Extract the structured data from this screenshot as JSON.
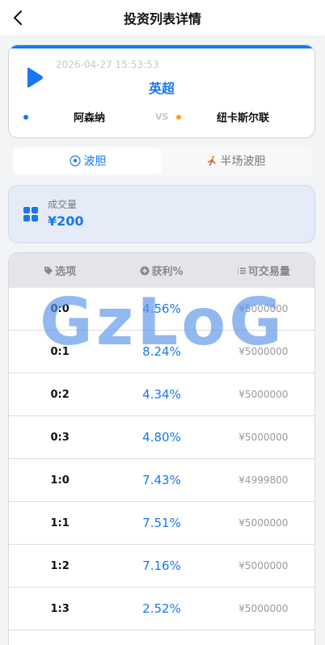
{
  "header": {
    "title": "投资列表详情"
  },
  "match": {
    "datetime": "2026-04-27 15:53:53",
    "league": "英超",
    "home_team": "阿森纳",
    "vs": "VS",
    "away_team": "纽卡斯尔联",
    "home_color": "#1877f2",
    "away_color": "#f6a11a"
  },
  "tabs": [
    {
      "label": "波胆",
      "icon": "soccer-ball-icon",
      "active": true
    },
    {
      "label": "半场波胆",
      "icon": "runner-icon",
      "active": false
    }
  ],
  "volume": {
    "label": "成交量",
    "value": "¥200"
  },
  "table": {
    "headers": [
      "选项",
      "获利%",
      "可交易量"
    ],
    "header_icons": [
      "tag-icon",
      "plus-circle-icon",
      "list-icon"
    ],
    "rows": [
      {
        "score": "0:0",
        "profit": "4.56%",
        "available": "¥5000000"
      },
      {
        "score": "0:1",
        "profit": "8.24%",
        "available": "¥5000000"
      },
      {
        "score": "0:2",
        "profit": "4.34%",
        "available": "¥5000000"
      },
      {
        "score": "0:3",
        "profit": "4.80%",
        "available": "¥5000000"
      },
      {
        "score": "1:0",
        "profit": "7.43%",
        "available": "¥4999800"
      },
      {
        "score": "1:1",
        "profit": "7.51%",
        "available": "¥5000000"
      },
      {
        "score": "1:2",
        "profit": "7.16%",
        "available": "¥5000000"
      },
      {
        "score": "1:3",
        "profit": "2.52%",
        "available": "¥5000000"
      }
    ]
  },
  "watermark": "GzLoG",
  "colors": {
    "accent": "#1877f2",
    "background": "#f3f4f6"
  }
}
